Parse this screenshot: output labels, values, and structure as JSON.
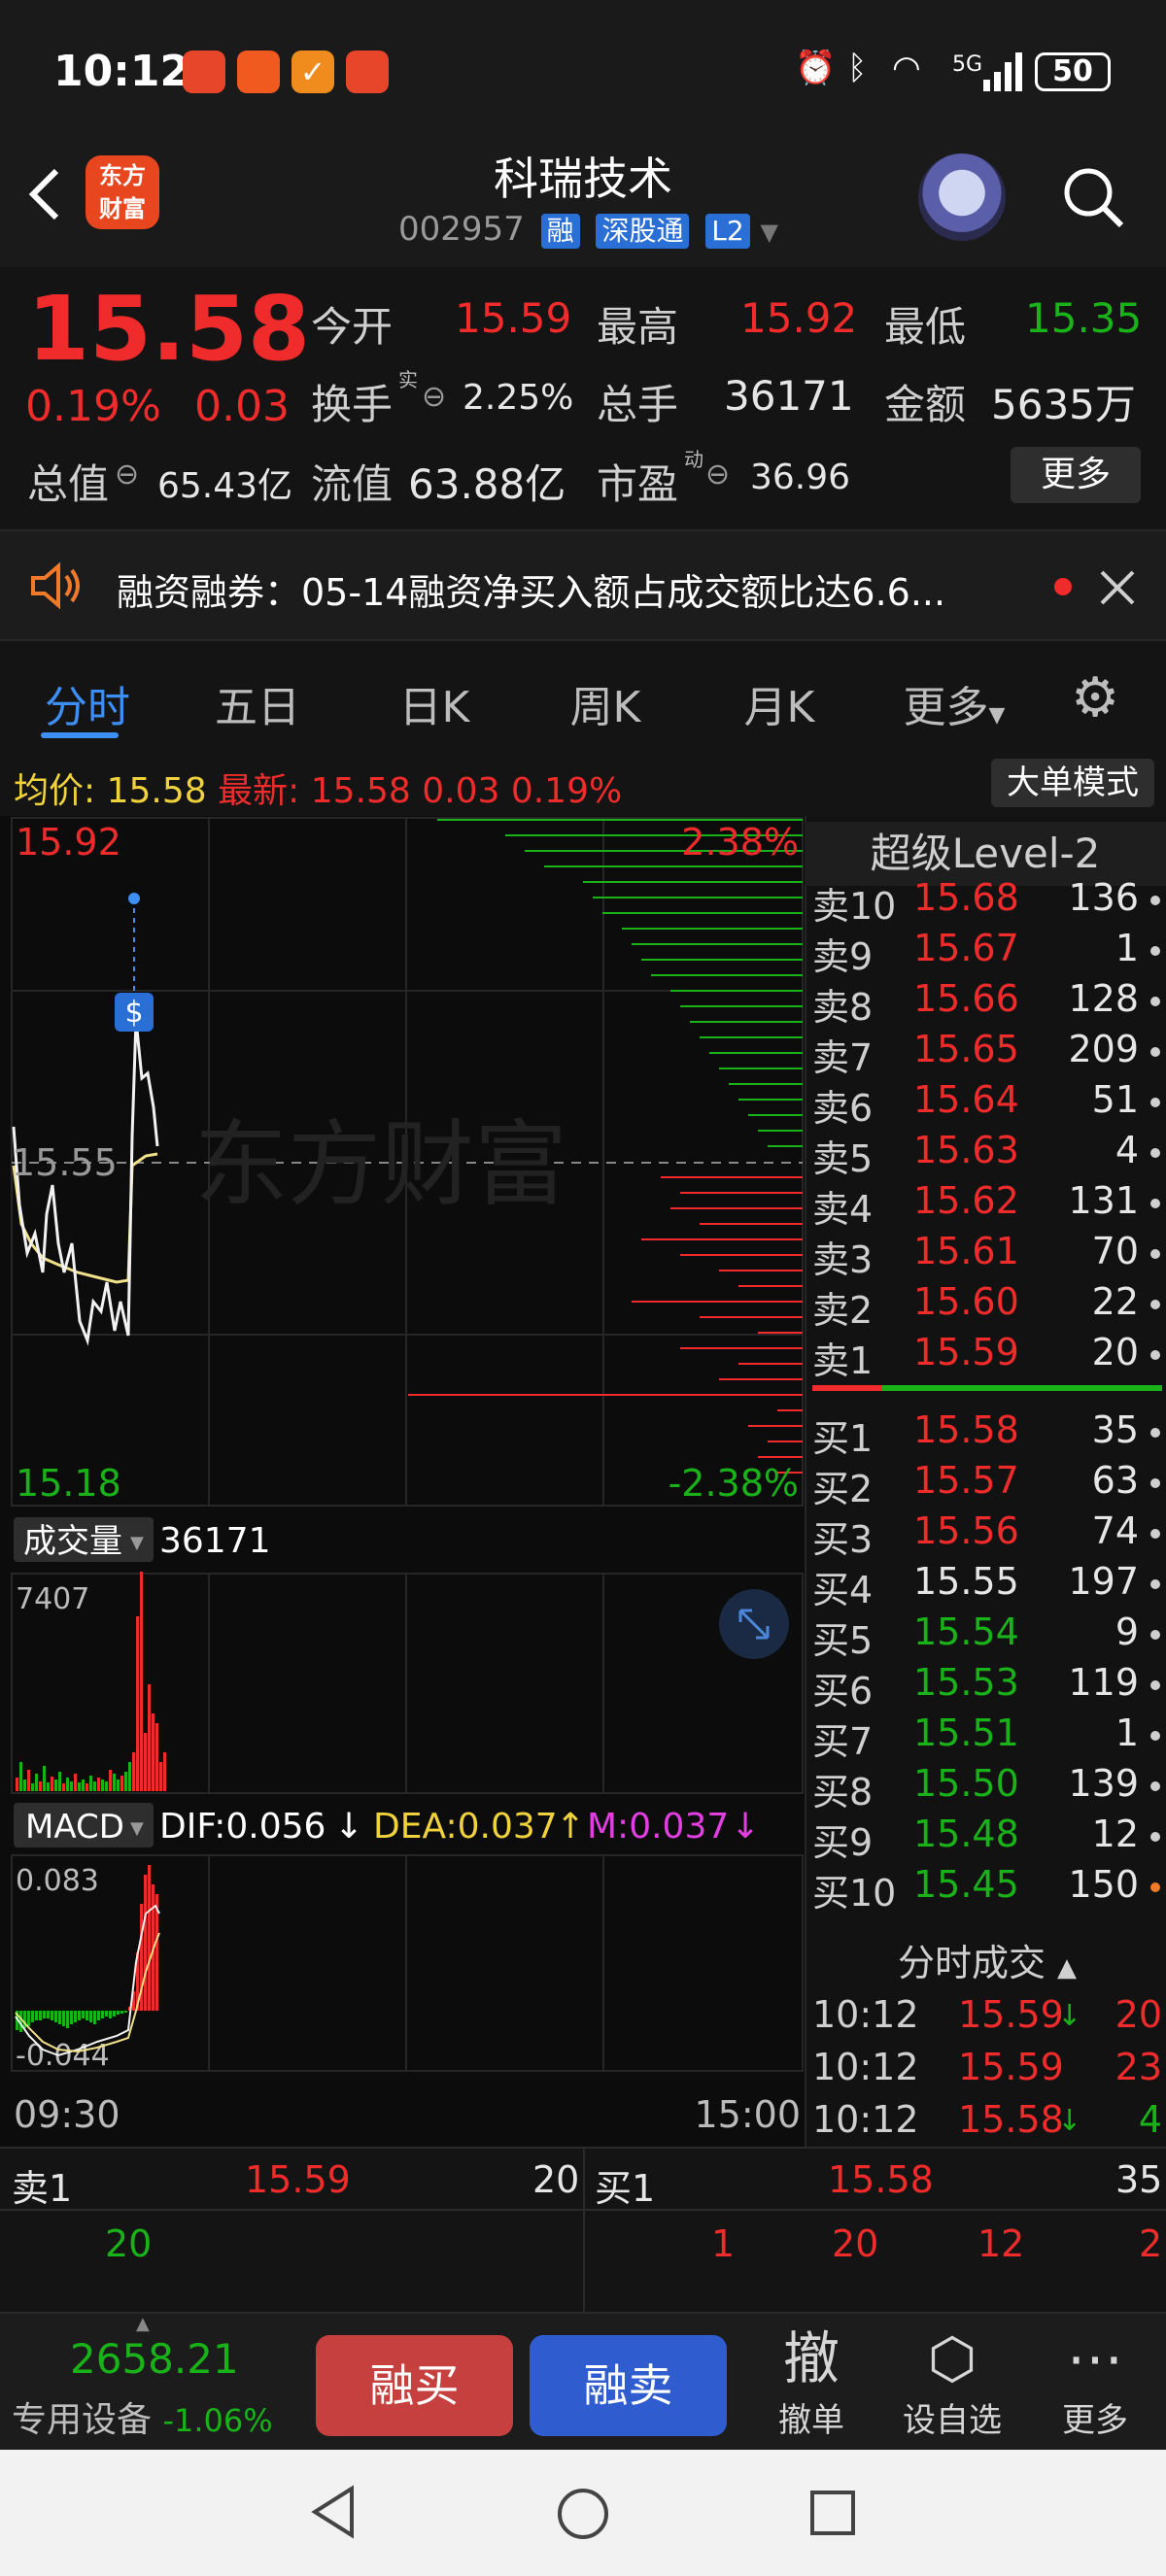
{
  "status_bar": {
    "time": "10:12",
    "battery": "50",
    "network": "5G"
  },
  "header": {
    "title": "科瑞技术",
    "code": "002957",
    "tags": [
      "融",
      "深股通",
      "L2"
    ],
    "logo_text": [
      "东方",
      "财富"
    ]
  },
  "quote": {
    "price": "15.58",
    "pct": "0.19%",
    "change": "0.03",
    "open_label": "今开",
    "open": "15.59",
    "high_label": "最高",
    "high": "15.92",
    "low_label": "最低",
    "low": "15.35",
    "turnover_label": "换手",
    "turnover_sup": "实",
    "turnover": "2.25%",
    "volume_label": "总手",
    "volume": "36171",
    "amount_label": "金额",
    "amount": "5635万",
    "mktcap_label": "总值",
    "mktcap": "65.43亿",
    "float_label": "流值",
    "float": "63.88亿",
    "pe_label": "市盈",
    "pe_sup": "动",
    "pe": "36.96",
    "more": "更多"
  },
  "notice": {
    "text": "融资融券：05-14融资净买入额占成交额比达6.6..."
  },
  "tabs": [
    "分时",
    "五日",
    "日K",
    "周K",
    "月K",
    "更多"
  ],
  "avgbar": {
    "avg_label": "均价:",
    "avg": "15.58",
    "last_label": "最新:",
    "last": "15.58",
    "chg": "0.03",
    "pct": "0.19%",
    "big_order": "大单模式"
  },
  "intraday": {
    "max_price": "15.92",
    "mid_price": "15.55",
    "min_price": "15.18",
    "max_pct": "2.38%",
    "min_pct": "-2.38%",
    "watermark": "东方财富",
    "marker": "$",
    "start_time": "09:30",
    "end_time": "15:00"
  },
  "volume_panel": {
    "label": "成交量",
    "value": "36171",
    "max": "7407"
  },
  "macd_panel": {
    "label": "MACD",
    "dif": "DIF:0.056",
    "dea": "DEA:0.037",
    "m": "M:0.037",
    "max": "0.083",
    "min": "-0.044"
  },
  "level2": {
    "title": "超级Level-2",
    "asks": [
      {
        "label": "卖10",
        "price": "15.68",
        "qty": "136"
      },
      {
        "label": "卖9",
        "price": "15.67",
        "qty": "1"
      },
      {
        "label": "卖8",
        "price": "15.66",
        "qty": "128"
      },
      {
        "label": "卖7",
        "price": "15.65",
        "qty": "209"
      },
      {
        "label": "卖6",
        "price": "15.64",
        "qty": "51"
      },
      {
        "label": "卖5",
        "price": "15.63",
        "qty": "4"
      },
      {
        "label": "卖4",
        "price": "15.62",
        "qty": "131"
      },
      {
        "label": "卖3",
        "price": "15.61",
        "qty": "70"
      },
      {
        "label": "卖2",
        "price": "15.60",
        "qty": "22"
      },
      {
        "label": "卖1",
        "price": "15.59",
        "qty": "20"
      }
    ],
    "bids": [
      {
        "label": "买1",
        "price": "15.58",
        "qty": "35"
      },
      {
        "label": "买2",
        "price": "15.57",
        "qty": "63"
      },
      {
        "label": "买3",
        "price": "15.56",
        "qty": "74"
      },
      {
        "label": "买4",
        "price": "15.55",
        "qty": "197"
      },
      {
        "label": "买5",
        "price": "15.54",
        "qty": "9"
      },
      {
        "label": "买6",
        "price": "15.53",
        "qty": "119"
      },
      {
        "label": "买7",
        "price": "15.51",
        "qty": "1"
      },
      {
        "label": "买8",
        "price": "15.50",
        "qty": "139"
      },
      {
        "label": "买9",
        "price": "15.48",
        "qty": "12"
      },
      {
        "label": "买10",
        "price": "15.45",
        "qty": "150"
      }
    ]
  },
  "ticks": {
    "title": "分时成交",
    "rows": [
      {
        "time": "10:12",
        "price": "15.59",
        "arrow": "↓",
        "qty": "20"
      },
      {
        "time": "10:12",
        "price": "15.59",
        "arrow": "",
        "qty": "23"
      },
      {
        "time": "10:12",
        "price": "15.58",
        "arrow": "↓",
        "qty": "4"
      }
    ]
  },
  "strip": {
    "ask_label": "卖1",
    "ask_price": "15.59",
    "ask_qty": "20",
    "bid_label": "买1",
    "bid_price": "15.58",
    "bid_qty": "35",
    "ask_queue": [
      "20"
    ],
    "bid_queue": [
      "1",
      "20",
      "12",
      "2"
    ]
  },
  "actionbar": {
    "index_value": "2658.21",
    "index_label": "专用设备",
    "index_pct": "-1.06%",
    "buy": "融买",
    "sell": "融卖",
    "cancel_icon_text": "撤",
    "cancel": "撤单",
    "watchlist": "设自选",
    "more": "更多"
  },
  "colors": {
    "up": "#ef2b2b",
    "down": "#19b319",
    "accent": "#3d8ef5",
    "avg_line": "#f0e08a"
  }
}
